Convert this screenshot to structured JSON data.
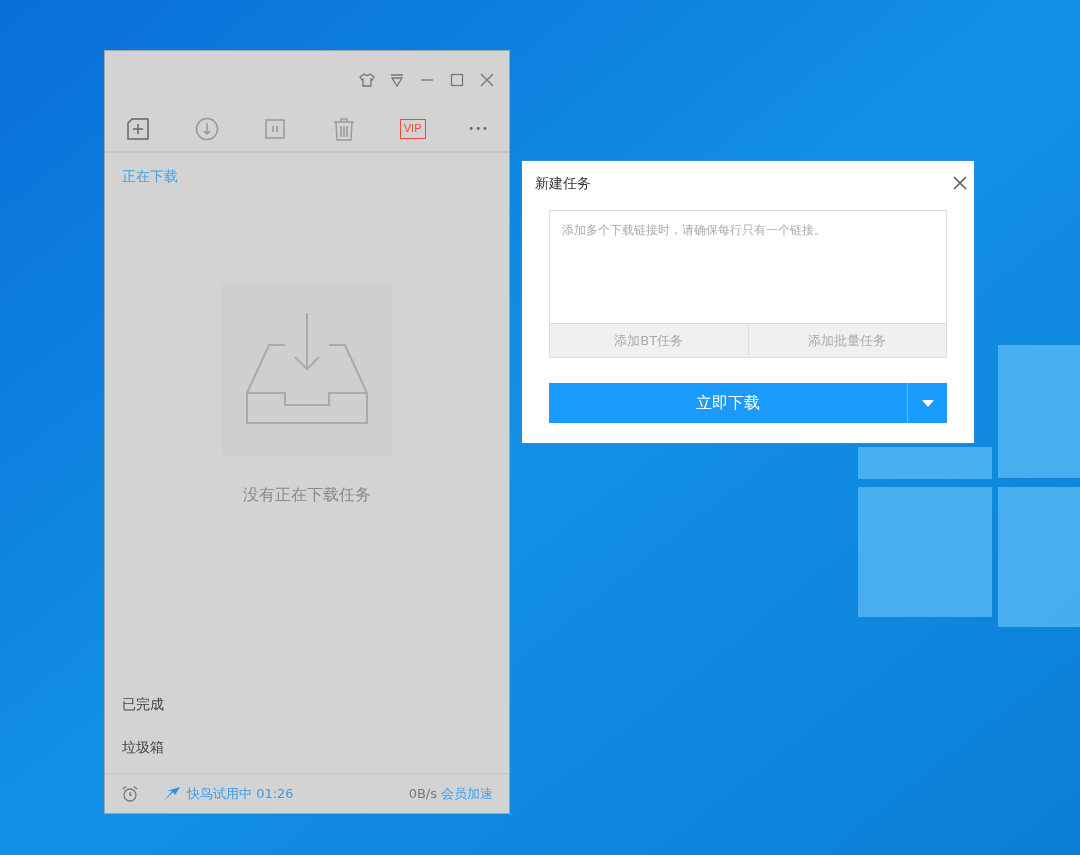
{
  "main_window": {
    "toolbar": [
      {
        "kind": "new"
      },
      {
        "kind": "download"
      },
      {
        "kind": "pause"
      },
      {
        "kind": "delete"
      },
      {
        "kind": "vip",
        "label": "VIP"
      },
      {
        "kind": "more",
        "label": "•••"
      }
    ],
    "nav_top": [
      {
        "label": "正在下载",
        "selected": true
      }
    ],
    "empty_message": "没有正在下载任务",
    "nav_bottom": [
      {
        "label": "已完成",
        "selected": false
      },
      {
        "label": "垃圾箱",
        "selected": false
      }
    ],
    "status_bar": {
      "trial": "快鸟试用中 01:26",
      "speed": "0B/s",
      "upgrade_link": "会员加速"
    }
  },
  "dialog": {
    "title": "新建任务",
    "placeholder": "添加多个下载链接时，请确保每行只有一个链接。",
    "tabs": [
      "添加BT任务",
      "添加批量任务"
    ],
    "primary_button": "立即下载"
  }
}
